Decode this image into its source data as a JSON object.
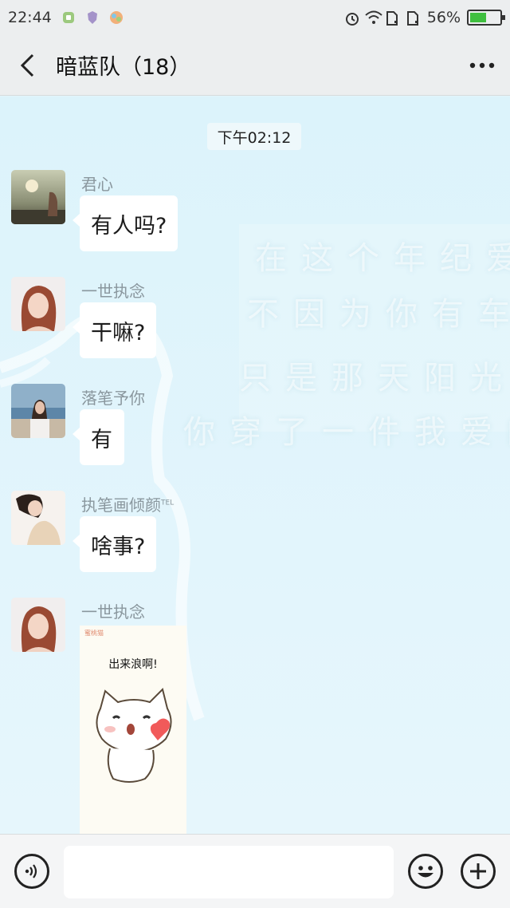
{
  "status_bar": {
    "time": "22:44",
    "battery_percent": "56%",
    "battery_level": 0.56,
    "icons": [
      "app-notify-icon",
      "app-shield-icon",
      "app-photo-icon",
      "alarm-icon",
      "wifi-icon",
      "sim1-icon",
      "sim2-icon",
      "battery-icon"
    ]
  },
  "header": {
    "title": "暗蓝队（18）",
    "back_icon": "chevron-left-icon",
    "more_icon": "more-icon"
  },
  "chat": {
    "timestamp": "下午02:12",
    "messages": [
      {
        "sender": "君心",
        "text": "有人吗?",
        "avatar": "avatar-sunset"
      },
      {
        "sender": "一世执念",
        "text": "干嘛?",
        "avatar": "avatar-woman-red-hair"
      },
      {
        "sender": "落笔予你",
        "text": "有",
        "avatar": "avatar-beach"
      },
      {
        "sender": "执笔画倾颜",
        "sender_badge": "TEL",
        "text": "啥事?",
        "avatar": "avatar-woman-white"
      },
      {
        "sender": "一世执念",
        "avatar": "avatar-woman-red-hair",
        "sticker": {
          "caption": "出来浪啊!",
          "watermark": "蜜桃猫"
        }
      }
    ]
  },
  "input_bar": {
    "voice_icon": "voice-icon",
    "input_value": "",
    "emoji_icon": "emoji-icon",
    "plus_icon": "plus-icon"
  },
  "colors": {
    "chat_bg": "#e3f5fb",
    "bar_bg": "#eceeef",
    "bubble_bg": "#ffffff",
    "sender_text": "#8a979e",
    "battery_green": "#3fbf3f"
  }
}
